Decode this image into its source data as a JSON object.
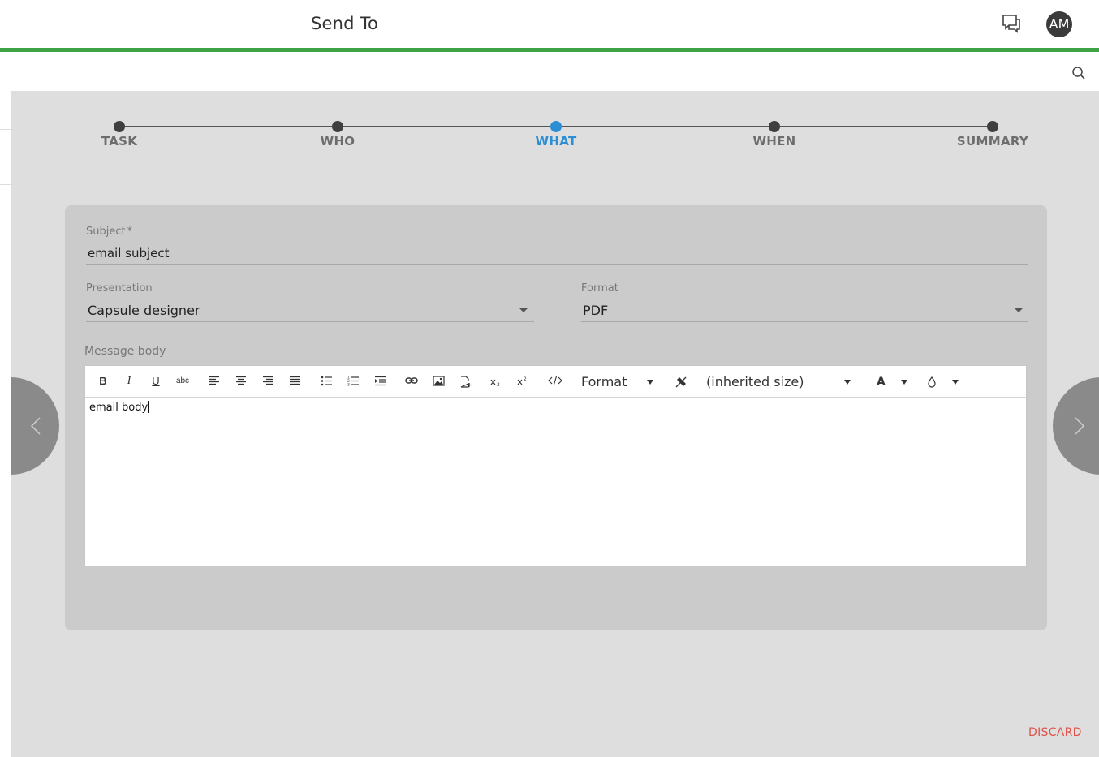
{
  "header": {
    "title": "Send To",
    "chat_icon": "chat-bubbles-icon",
    "avatar_initials": "AM",
    "accent_color": "#3da344"
  },
  "search": {
    "placeholder": "",
    "icon": "search-icon"
  },
  "stepper": {
    "steps": [
      {
        "label": "TASK",
        "active": false
      },
      {
        "label": "WHO",
        "active": false
      },
      {
        "label": "WHAT",
        "active": true
      },
      {
        "label": "WHEN",
        "active": false
      },
      {
        "label": "SUMMARY",
        "active": false
      }
    ],
    "active_color": "#2c8fd6"
  },
  "form": {
    "subject": {
      "label": "Subject",
      "required_mark": "*",
      "value": "email subject"
    },
    "presentation": {
      "label": "Presentation",
      "value": "Capsule designer"
    },
    "format": {
      "label": "Format",
      "value": "PDF"
    },
    "message_body": {
      "label": "Message body",
      "toolbar": {
        "bold": "B",
        "italic": "I",
        "underline": "U",
        "strikethrough": "abc",
        "format_label": "Format",
        "size_label": "(inherited size)",
        "font_color_label": "A",
        "icons": [
          "align-left-icon",
          "align-center-icon",
          "align-right-icon",
          "align-justify-icon",
          "bullet-list-icon",
          "numbered-list-icon",
          "indent-icon",
          "link-icon",
          "image-icon",
          "insert-file-icon",
          "subscript-icon",
          "superscript-icon",
          "code-view-icon",
          "clear-format-icon",
          "highlight-color-icon"
        ]
      },
      "value": "email body"
    }
  },
  "navigation": {
    "prev_icon": "chevron-left-icon",
    "next_icon": "chevron-right-icon"
  },
  "actions": {
    "discard_label": "DISCARD",
    "discard_color": "#e0524a"
  }
}
